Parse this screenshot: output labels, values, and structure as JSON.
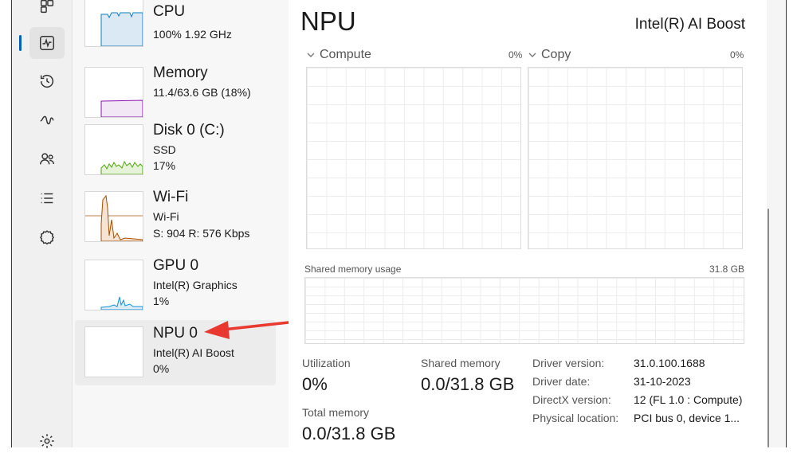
{
  "nav": {
    "items": [
      {
        "icon": "apps-icon"
      },
      {
        "icon": "performance-icon",
        "active": true
      },
      {
        "icon": "app-history-icon"
      },
      {
        "icon": "startup-apps-icon"
      },
      {
        "icon": "users-icon"
      },
      {
        "icon": "details-icon"
      },
      {
        "icon": "services-icon"
      },
      {
        "icon": "settings-icon"
      }
    ]
  },
  "perf_list": [
    {
      "name": "CPU",
      "line1": "100%  1.92 GHz",
      "line2": ""
    },
    {
      "name": "Memory",
      "line1": "11.4/63.6 GB (18%)",
      "line2": ""
    },
    {
      "name": "Disk 0 (C:)",
      "line1": "SSD",
      "line2": "17%"
    },
    {
      "name": "Wi-Fi",
      "line1": "Wi-Fi",
      "line2": "S: 904  R: 576 Kbps"
    },
    {
      "name": "GPU 0",
      "line1": "Intel(R) Graphics",
      "line2": "1%"
    },
    {
      "name": "NPU 0",
      "line1": "Intel(R) AI Boost",
      "line2": "0%"
    }
  ],
  "detail": {
    "title": "NPU",
    "subtitle": "Intel(R) AI Boost",
    "compute_label": "Compute",
    "compute_pct": "0%",
    "copy_label": "Copy",
    "copy_pct": "0%",
    "shared_usage_label": "Shared memory usage",
    "shared_usage_max": "31.8 GB",
    "utilization_label": "Utilization",
    "utilization_value": "0%",
    "shared_memory_label": "Shared memory",
    "shared_memory_value": "0.0/31.8 GB",
    "total_memory_label": "Total memory",
    "total_memory_value": "0.0/31.8 GB",
    "properties": [
      {
        "key": "Driver version:",
        "value": "31.0.100.1688"
      },
      {
        "key": "Driver date:",
        "value": "31-10-2023"
      },
      {
        "key": "DirectX version:",
        "value": "12 (FL 1.0 : Compute)"
      },
      {
        "key": "Physical location:",
        "value": "PCI bus 0, device 1..."
      }
    ]
  },
  "colors": {
    "accent": "#005fb8",
    "cpu": "#117dbb",
    "memory": "#8b12ae",
    "disk": "#4da60c",
    "wifi": "#a74f01",
    "gpu": "#1190d8",
    "annotation_arrow": "#e8382f"
  }
}
